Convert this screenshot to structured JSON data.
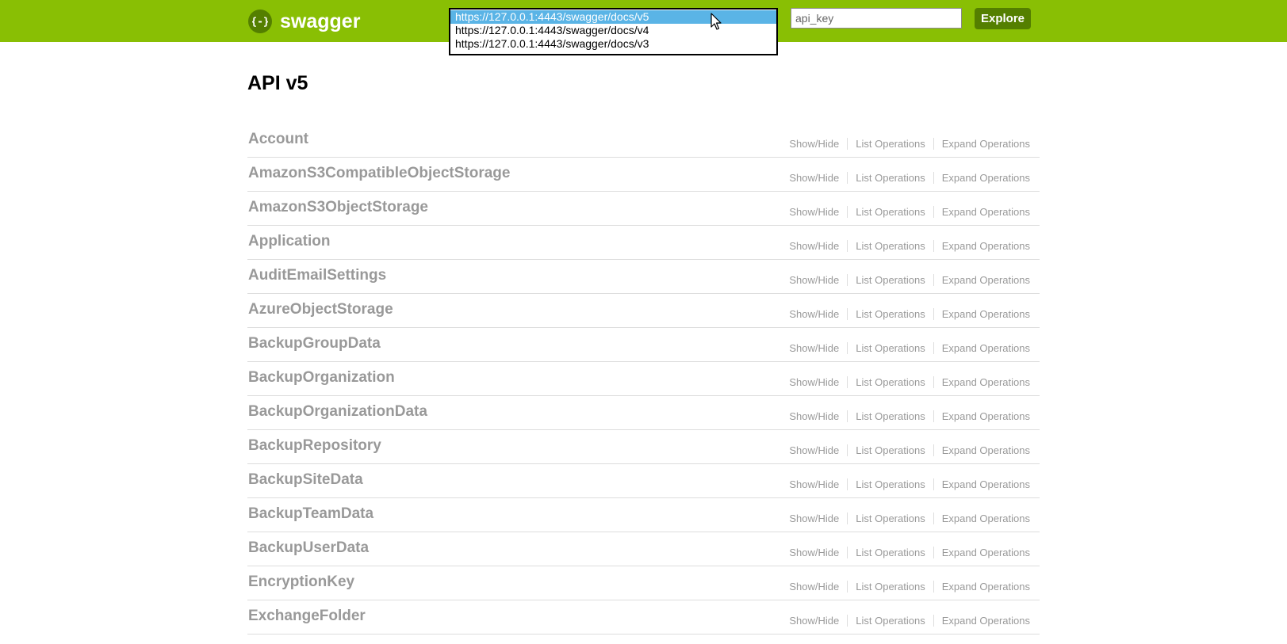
{
  "header": {
    "logo_text": "swagger",
    "url_options": [
      "https://127.0.0.1:4443/swagger/docs/v5",
      "https://127.0.0.1:4443/swagger/docs/v4",
      "https://127.0.0.1:4443/swagger/docs/v3"
    ],
    "selected_url_index": 0,
    "api_key_value": "api_key",
    "explore_label": "Explore"
  },
  "page_title": "API v5",
  "action_labels": {
    "show_hide": "Show/Hide",
    "list_operations": "List Operations",
    "expand_operations": "Expand Operations"
  },
  "resources": [
    {
      "name": "Account"
    },
    {
      "name": "AmazonS3CompatibleObjectStorage"
    },
    {
      "name": "AmazonS3ObjectStorage"
    },
    {
      "name": "Application"
    },
    {
      "name": "AuditEmailSettings"
    },
    {
      "name": "AzureObjectStorage"
    },
    {
      "name": "BackupGroupData"
    },
    {
      "name": "BackupOrganization"
    },
    {
      "name": "BackupOrganizationData"
    },
    {
      "name": "BackupRepository"
    },
    {
      "name": "BackupSiteData"
    },
    {
      "name": "BackupTeamData"
    },
    {
      "name": "BackupUserData"
    },
    {
      "name": "EncryptionKey"
    },
    {
      "name": "ExchangeFolder"
    }
  ],
  "colors": {
    "header_bg": "#89bf04",
    "accent_dark": "#547f00",
    "selected_option_bg": "#5ab4e6",
    "resource_text": "#999999"
  }
}
